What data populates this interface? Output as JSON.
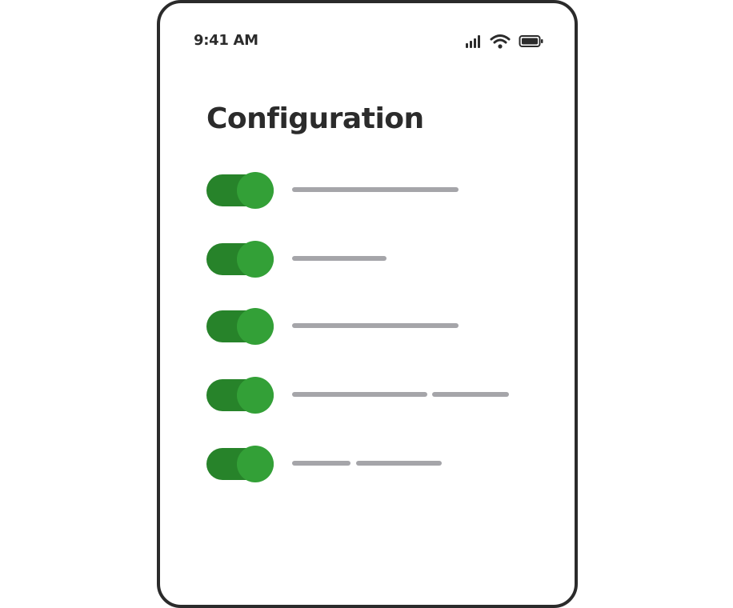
{
  "status_bar": {
    "time": "9:41 AM",
    "icons": [
      "signal-icon",
      "wifi-icon",
      "battery-icon"
    ]
  },
  "screen": {
    "title": "Configuration"
  },
  "settings": [
    {
      "enabled": true
    },
    {
      "enabled": true
    },
    {
      "enabled": true
    },
    {
      "enabled": true
    },
    {
      "enabled": true
    }
  ],
  "colors": {
    "toggle_track": "#27832a",
    "toggle_knob": "#33a037",
    "text_dark": "#2b2b2b",
    "placeholder_line": "#a5a5a9"
  }
}
